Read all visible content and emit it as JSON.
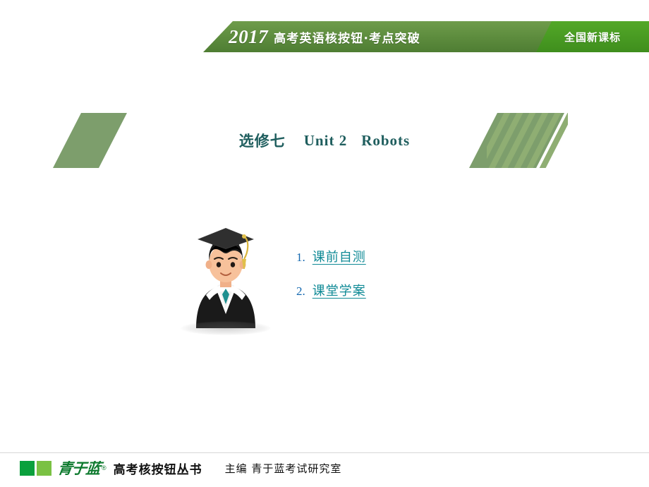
{
  "header": {
    "year": "2017",
    "title": "高考英语核按钮·考点突破",
    "badge": "全国新课标"
  },
  "banner": {
    "book": "选修七",
    "unit": "Unit 2",
    "topic": "Robots"
  },
  "contents": [
    {
      "num": "1.",
      "label": "课前自测"
    },
    {
      "num": "2.",
      "label": "课堂学案"
    }
  ],
  "mascot": {
    "name": "graduate-student-mascot"
  },
  "footer": {
    "logo_text": "青于蓝",
    "registered": "®",
    "series": "高考核按钮丛书",
    "editor": "主编 青于蓝考试研究室"
  },
  "colors": {
    "header_green": "#5b8a3c",
    "badge_green": "#46931f",
    "banner_olive": "#7d9e6c",
    "title_teal": "#1f5e5e",
    "link_teal": "#0f8a96",
    "num_blue": "#1468b0",
    "logo_green": "#0aa03c"
  }
}
